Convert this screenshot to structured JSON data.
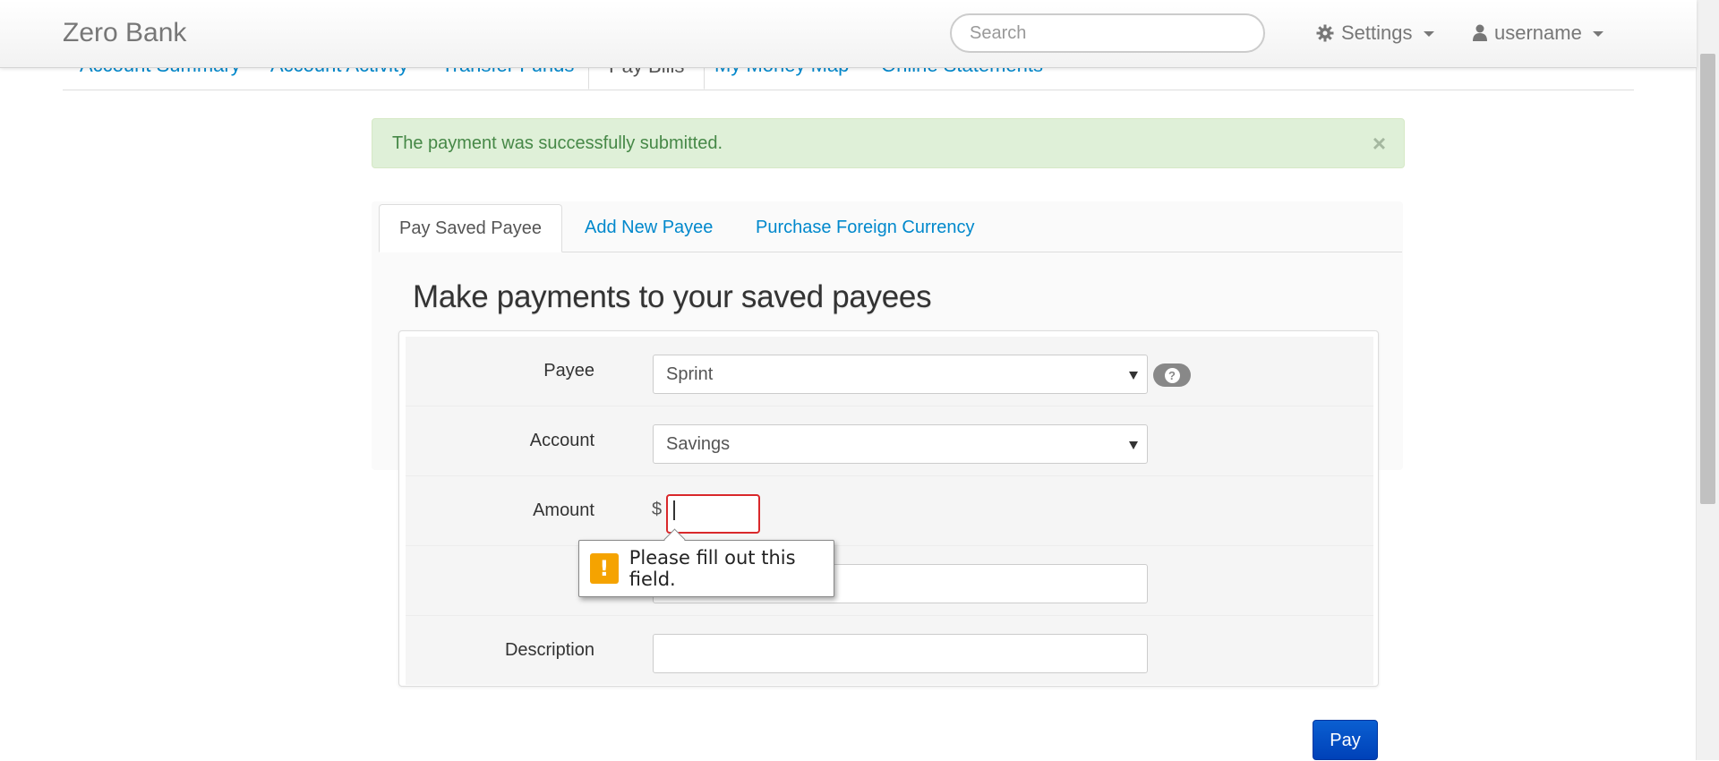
{
  "navbar": {
    "brand": "Zero Bank",
    "search_placeholder": "Search",
    "settings_label": "Settings",
    "user_label": "username"
  },
  "main_tabs": [
    {
      "label": "Account Summary"
    },
    {
      "label": "Account Activity"
    },
    {
      "label": "Transfer Funds"
    },
    {
      "label": "Pay Bills"
    },
    {
      "label": "My Money Map"
    },
    {
      "label": "Online Statements"
    }
  ],
  "main_tabs_active": "Pay Bills",
  "alert": {
    "message": "The payment was successfully submitted.",
    "close_glyph": "×"
  },
  "sub_tabs": [
    {
      "label": "Pay Saved Payee"
    },
    {
      "label": "Add New Payee"
    },
    {
      "label": "Purchase Foreign Currency"
    }
  ],
  "sub_tabs_active": "Pay Saved Payee",
  "heading": "Make payments to your saved payees",
  "form": {
    "payee_label": "Payee",
    "payee_value": "Sprint",
    "help_glyph": "?",
    "account_label": "Account",
    "account_value": "Savings",
    "amount_label": "Amount",
    "currency_symbol": "$",
    "amount_value": "",
    "description_label": "Description",
    "description_value": ""
  },
  "validation_tooltip": {
    "icon_glyph": "!",
    "message": "Please fill out this field."
  },
  "pay_button": "Pay",
  "colors": {
    "link": "#0088cc",
    "alert_bg": "#dff0d8",
    "alert_text": "#468847",
    "error_border": "#d9282b",
    "warning_icon": "#f5a300",
    "pay_button": "#0a5fd1"
  }
}
